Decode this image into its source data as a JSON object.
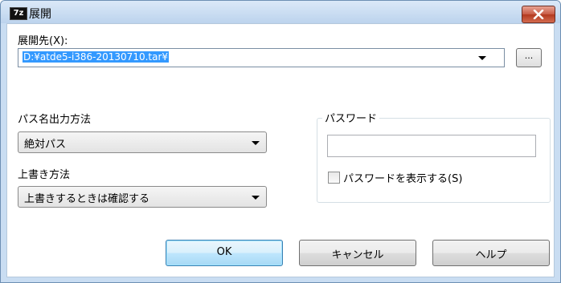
{
  "window": {
    "app_icon_text": "7z",
    "title": "展開"
  },
  "destination": {
    "label": "展開先(X):",
    "path": "D:¥atde5-i386-20130710.tar¥",
    "browse_label": "..."
  },
  "path_mode": {
    "label": "パス名出力方法",
    "selected": "絶対パス"
  },
  "overwrite_mode": {
    "label": "上書き方法",
    "selected": "上書きするときは確認する"
  },
  "password": {
    "group_label": "パスワード",
    "value": "",
    "show_label": "パスワードを表示する(S)",
    "show_checked": false
  },
  "buttons": {
    "ok": "OK",
    "cancel": "キャンセル",
    "help": "ヘルプ"
  }
}
